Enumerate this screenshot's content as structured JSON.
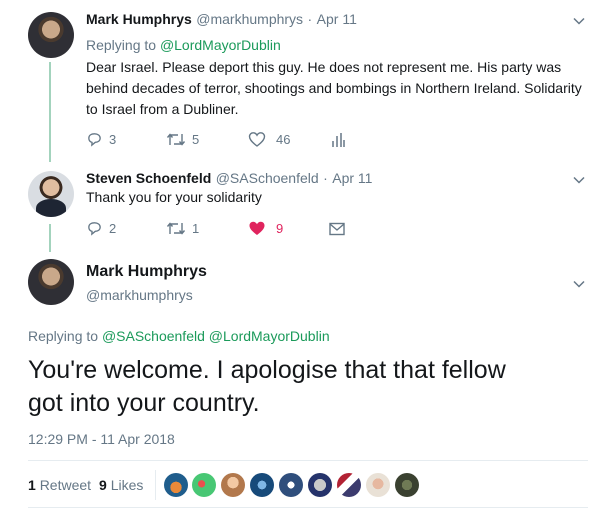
{
  "tweet1": {
    "name": "Mark Humphrys",
    "handle": "@markhumphrys",
    "sep": "·",
    "date": "Apr 11",
    "replying_prefix": "Replying to",
    "replying_to": "@LordMayorDublin",
    "text": "Dear Israel. Please deport this guy. He does not represent me. His party was behind decades of terror, shootings and bombings in Northern Ireland. Solidarity to Israel from  a Dubliner.",
    "replies": "3",
    "retweets": "5",
    "likes": "46"
  },
  "tweet2": {
    "name": "Steven Schoenfeld",
    "handle": "@SASchoenfeld",
    "sep": "·",
    "date": "Apr 11",
    "text": "Thank you for your solidarity",
    "replies": "2",
    "retweets": "1",
    "likes": "9"
  },
  "main": {
    "name": "Mark Humphrys",
    "handle": "@markhumphrys",
    "replying_prefix": "Replying to",
    "replying_to_1": "@SASchoenfeld",
    "replying_to_2": "@LordMayorDublin",
    "text_line1": "You're welcome. I apologise that that fellow",
    "text_line2": "got into your country.",
    "timestamp": "12:29 PM - 11 Apr 2018",
    "retweet_count": "1",
    "retweet_label": "Retweet",
    "like_count": "9",
    "like_label": "Likes"
  },
  "icons": [
    "chevron-down-icon",
    "reply-icon",
    "retweet-icon",
    "heart-icon",
    "analytics-icon",
    "mail-icon"
  ],
  "colors": {
    "accent_green": "#1b9a5a",
    "like_red": "#e0245e",
    "muted": "#657786",
    "thread": "#a3d3bd"
  }
}
